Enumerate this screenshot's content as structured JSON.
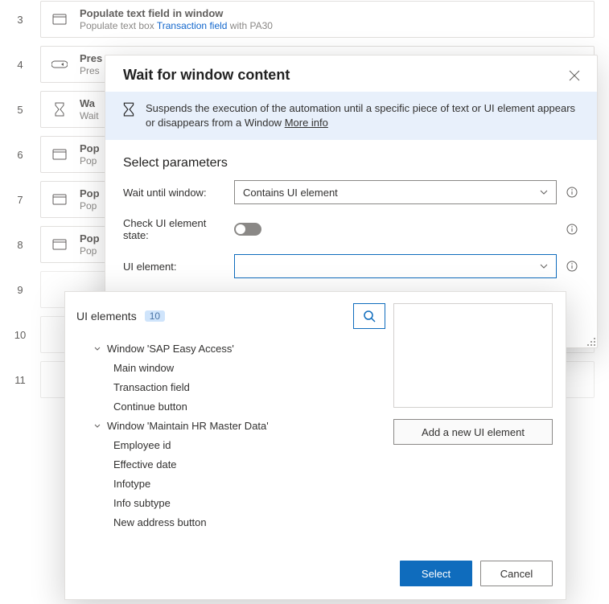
{
  "steps": [
    {
      "num": "3",
      "icon": "window",
      "title": "Populate text field in window",
      "sub": "Populate text box ",
      "link": "Transaction field",
      "sub2": " with PA30"
    },
    {
      "num": "4",
      "icon": "press",
      "title": "Pres",
      "sub": "Pres"
    },
    {
      "num": "5",
      "icon": "hourglass",
      "title": "Wa",
      "sub": "Wait"
    },
    {
      "num": "6",
      "icon": "window",
      "title": "Pop",
      "sub": "Pop"
    },
    {
      "num": "7",
      "icon": "window",
      "title": "Pop",
      "sub": "Pop"
    },
    {
      "num": "8",
      "icon": "window",
      "title": "Pop",
      "sub": "Pop"
    },
    {
      "num": "9",
      "icon": "",
      "title": "",
      "sub": ""
    },
    {
      "num": "10",
      "icon": "",
      "title": "",
      "sub": ""
    },
    {
      "num": "11",
      "icon": "",
      "title": "",
      "sub": ""
    }
  ],
  "dialog": {
    "title": "Wait for window content",
    "info": "Suspends the execution of the automation until a specific piece of text or UI element appears or disappears from a Window ",
    "more_info": "More info",
    "section": "Select parameters",
    "label_wait": "Wait until window:",
    "value_wait": "Contains UI element",
    "label_check": "Check UI element state:",
    "label_ui": "UI element:"
  },
  "dropdown": {
    "heading": "UI elements",
    "count": "10",
    "tree": [
      {
        "level": 1,
        "expandable": true,
        "label": "Window 'SAP Easy Access'"
      },
      {
        "level": 2,
        "expandable": false,
        "label": "Main window"
      },
      {
        "level": 2,
        "expandable": false,
        "label": "Transaction field"
      },
      {
        "level": 2,
        "expandable": false,
        "label": "Continue button"
      },
      {
        "level": 1,
        "expandable": true,
        "label": "Window 'Maintain HR Master Data'"
      },
      {
        "level": 2,
        "expandable": false,
        "label": "Employee id"
      },
      {
        "level": 2,
        "expandable": false,
        "label": "Effective date"
      },
      {
        "level": 2,
        "expandable": false,
        "label": "Infotype"
      },
      {
        "level": 2,
        "expandable": false,
        "label": "Info subtype"
      },
      {
        "level": 2,
        "expandable": false,
        "label": "New address button"
      }
    ],
    "add_button": "Add a new UI element",
    "select_button": "Select",
    "cancel_button": "Cancel"
  }
}
